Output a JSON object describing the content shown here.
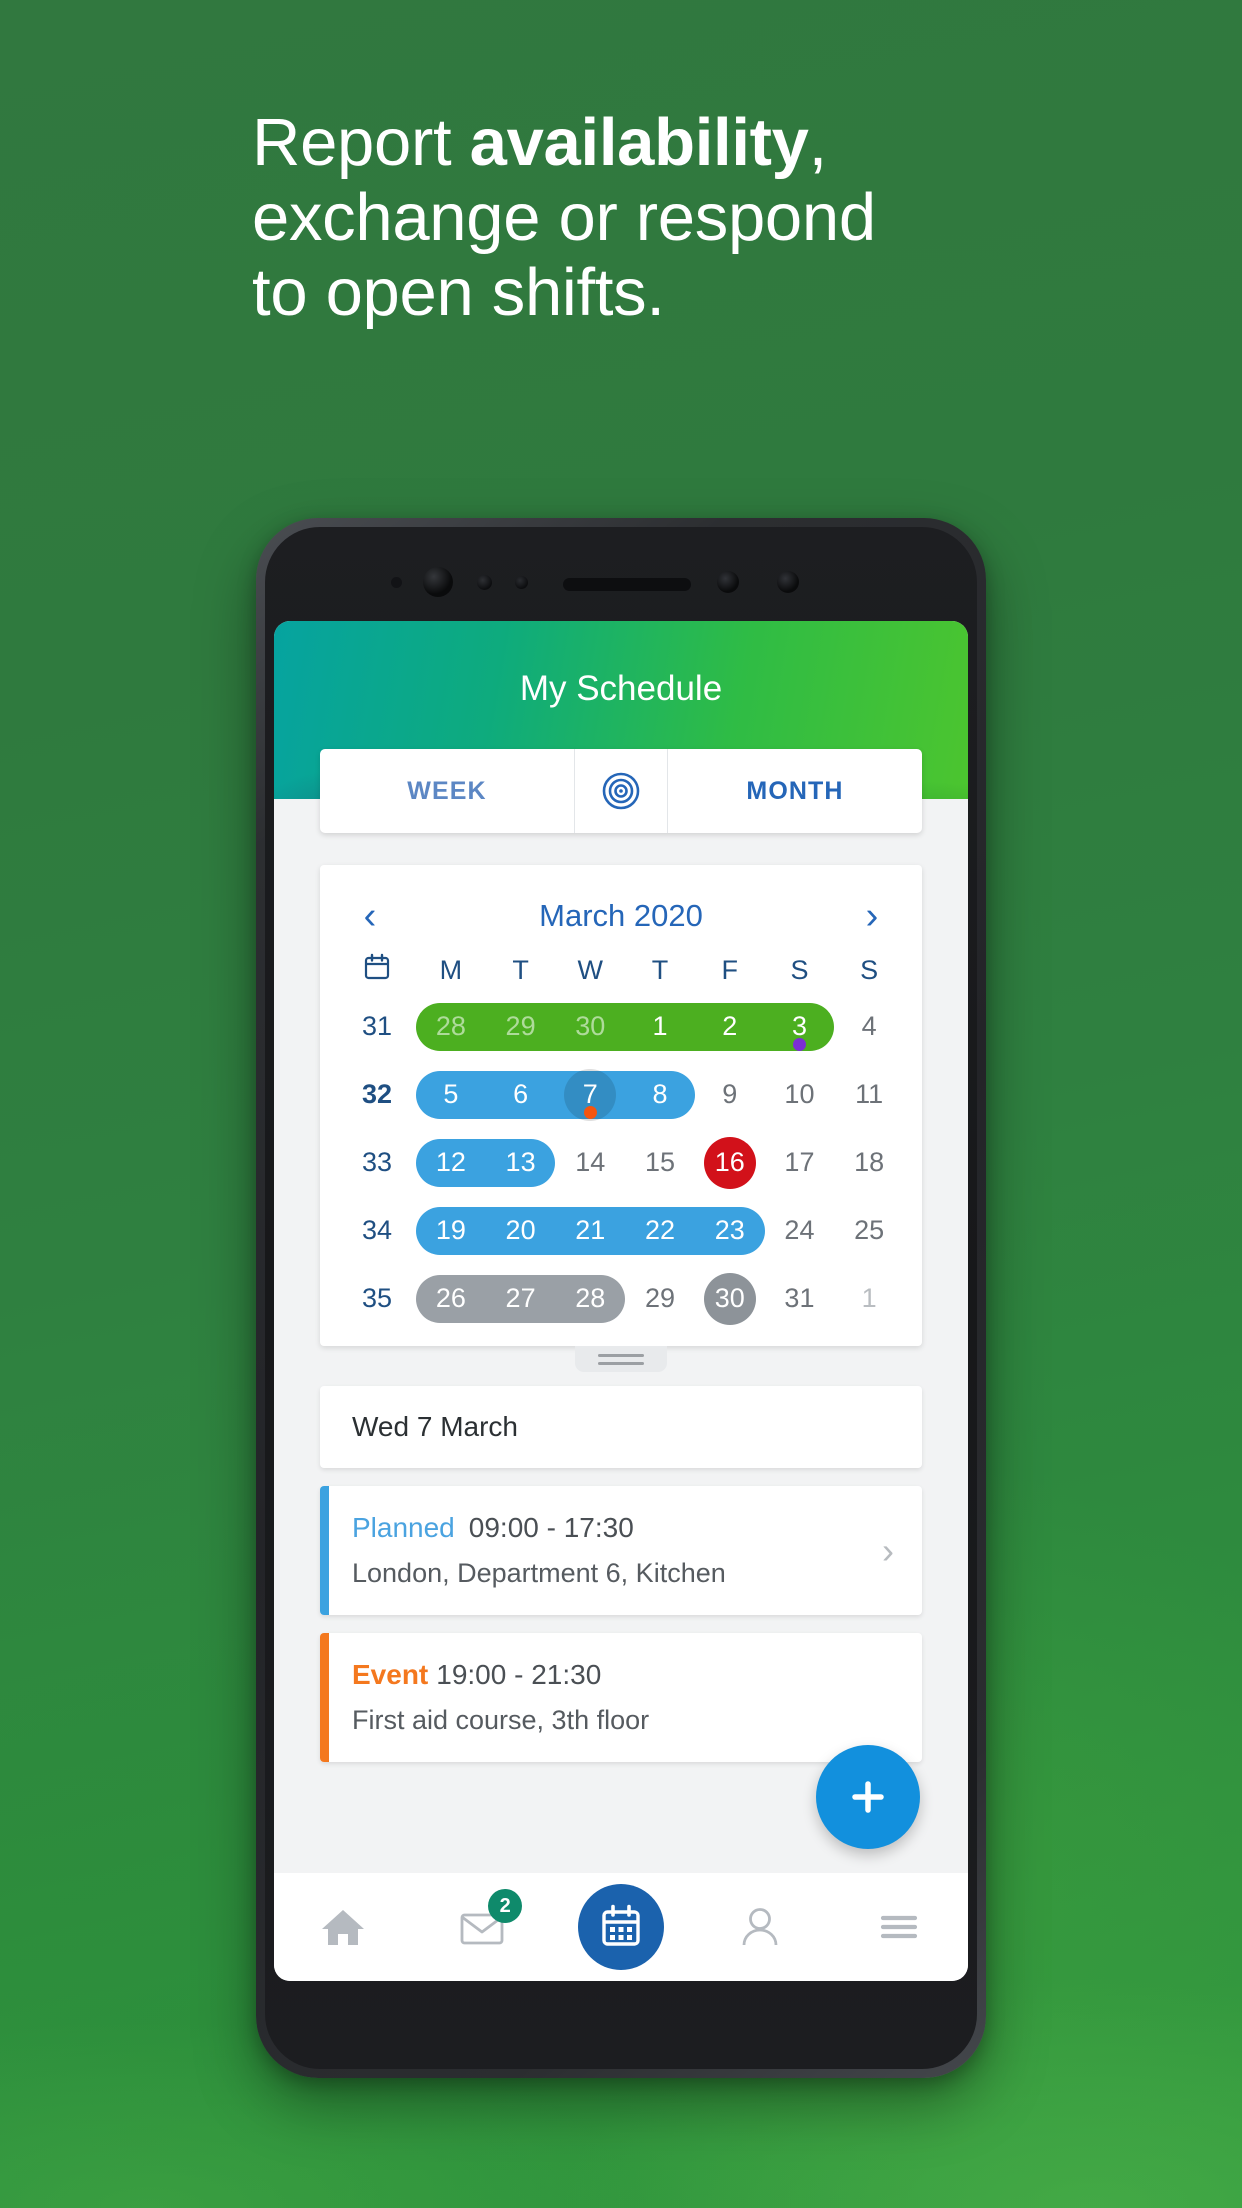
{
  "headline": {
    "part1": "Report ",
    "bold": "availability",
    "part2": ",",
    "line2": "exchange or respond",
    "line3": "to open shifts."
  },
  "app": {
    "title": "My Schedule",
    "tabs": {
      "week_label": "WEEK",
      "target_icon": "target-icon",
      "month_label": "MONTH"
    },
    "calendar": {
      "prev_icon": "chevron-left-icon",
      "next_icon": "chevron-right-icon",
      "month_label": "March 2020",
      "week_col_icon": "calendar-icon",
      "day_headers": [
        "M",
        "T",
        "W",
        "T",
        "F",
        "S",
        "S"
      ],
      "rows": [
        {
          "week": "31",
          "current": false,
          "days": [
            {
              "n": "28",
              "style": "on-dim"
            },
            {
              "n": "29",
              "style": "on-dim"
            },
            {
              "n": "30",
              "style": "on-dim"
            },
            {
              "n": "1",
              "style": "on"
            },
            {
              "n": "2",
              "style": "on"
            },
            {
              "n": "3",
              "style": "on"
            },
            {
              "n": "4",
              "style": "plain"
            }
          ],
          "pill": {
            "color": "green",
            "start": 0,
            "end": 5
          },
          "dot": {
            "color": "purple",
            "index": 5
          }
        },
        {
          "week": "32",
          "current": true,
          "days": [
            {
              "n": "5",
              "style": "on"
            },
            {
              "n": "6",
              "style": "on"
            },
            {
              "n": "7",
              "style": "on"
            },
            {
              "n": "8",
              "style": "on"
            },
            {
              "n": "9",
              "style": "plain"
            },
            {
              "n": "10",
              "style": "plain"
            },
            {
              "n": "11",
              "style": "plain"
            }
          ],
          "pill": {
            "color": "blue",
            "start": 0,
            "end": 3
          },
          "selected": 2,
          "dot": {
            "color": "orange",
            "index": 2
          }
        },
        {
          "week": "33",
          "current": false,
          "days": [
            {
              "n": "12",
              "style": "on"
            },
            {
              "n": "13",
              "style": "on"
            },
            {
              "n": "14",
              "style": "plain"
            },
            {
              "n": "15",
              "style": "plain"
            },
            {
              "n": "16",
              "style": "on"
            },
            {
              "n": "17",
              "style": "plain"
            },
            {
              "n": "18",
              "style": "plain"
            }
          ],
          "pill": {
            "color": "blue",
            "start": 0,
            "end": 1
          },
          "circle": {
            "color": "red",
            "index": 4
          }
        },
        {
          "week": "34",
          "current": false,
          "days": [
            {
              "n": "19",
              "style": "on"
            },
            {
              "n": "20",
              "style": "on"
            },
            {
              "n": "21",
              "style": "on"
            },
            {
              "n": "22",
              "style": "on"
            },
            {
              "n": "23",
              "style": "on"
            },
            {
              "n": "24",
              "style": "plain"
            },
            {
              "n": "25",
              "style": "plain"
            }
          ],
          "pill": {
            "color": "blue",
            "start": 0,
            "end": 4
          }
        },
        {
          "week": "35",
          "current": false,
          "days": [
            {
              "n": "26",
              "style": "on"
            },
            {
              "n": "27",
              "style": "on"
            },
            {
              "n": "28",
              "style": "on"
            },
            {
              "n": "29",
              "style": "plain"
            },
            {
              "n": "30",
              "style": "on"
            },
            {
              "n": "31",
              "style": "plain"
            },
            {
              "n": "1",
              "style": "dim"
            }
          ],
          "pill": {
            "color": "gray",
            "start": 0,
            "end": 2
          },
          "circle": {
            "color": "gray",
            "index": 4
          }
        }
      ],
      "drag_handle": "drag-handle"
    },
    "day_header": "Wed 7 March",
    "events": [
      {
        "kind": "Planned",
        "kind_class": "planned",
        "time": "09:00 - 17:30",
        "detail": "London, Department 6, Kitchen",
        "has_chevron": true,
        "accent": "#3ba2e0"
      },
      {
        "kind": "Event",
        "kind_class": "event",
        "time": "19:00 - 21:30",
        "detail": "First aid course, 3th floor",
        "has_chevron": false,
        "accent": "#f4781e"
      }
    ],
    "fab": {
      "icon": "plus-icon",
      "color": "#1290dd"
    },
    "bottom_nav": [
      {
        "icon": "home-icon",
        "active": false
      },
      {
        "icon": "mail-icon",
        "active": false,
        "badge": "2"
      },
      {
        "icon": "calendar-icon",
        "active": true
      },
      {
        "icon": "person-icon",
        "active": false
      },
      {
        "icon": "hamburger-menu-icon",
        "active": false
      }
    ]
  },
  "colors": {
    "background_green": "#2f8040",
    "header_gradient_start": "#06a3a0",
    "header_gradient_end": "#4cc52f",
    "accent_blue": "#2566b8",
    "pill_blue": "#3ba2e0",
    "pill_green": "#4caf20",
    "pill_gray": "#9aa0a6",
    "marker_red": "#d2111a",
    "orange": "#f4781e",
    "badge_teal": "#0f8a6b"
  }
}
